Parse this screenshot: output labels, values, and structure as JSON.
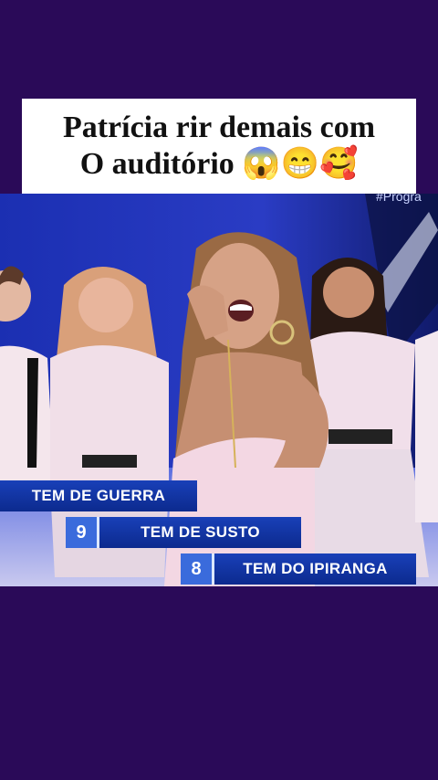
{
  "caption": {
    "line1": "Patrícia rir demais com",
    "line2": "O auditório 😱😁🥰"
  },
  "video": {
    "watermark": "#Progra",
    "answers": [
      {
        "number": "",
        "text": "TEM DE GUERRA"
      },
      {
        "number": "9",
        "text": "TEM DE SUSTO"
      },
      {
        "number": "8",
        "text": "TEM DO IPIRANGA"
      }
    ]
  },
  "colors": {
    "background": "#2a0a58",
    "caption_bg": "#ffffff",
    "answer_box": "#1940b8",
    "number_box": "#3a6bdc"
  }
}
